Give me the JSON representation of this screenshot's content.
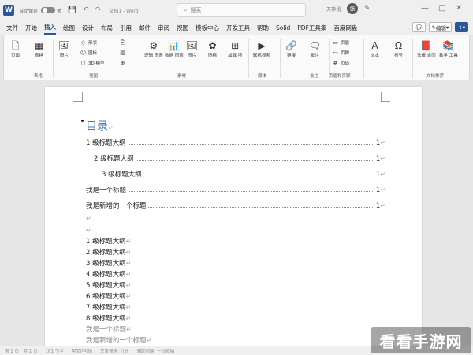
{
  "titlebar": {
    "app_icon": "W",
    "autosave_label": "自动保存",
    "toggle_state": "关",
    "doc_title": "文档1 - Word",
    "search_placeholder": "搜索",
    "user_name": "天神 张",
    "avatar_letter": "张",
    "window_controls": [
      "—",
      "▢",
      "✕"
    ]
  },
  "menu": {
    "tabs": [
      "文件",
      "开始",
      "插入",
      "绘图",
      "设计",
      "布局",
      "引用",
      "邮件",
      "审阅",
      "视图",
      "模板中心",
      "开发工具",
      "帮助",
      "Solid",
      "PDF工具集",
      "百度网盘"
    ],
    "active_tab": "插入",
    "comment_btn": "💬",
    "edit_btn": "编辑",
    "share_btn": "共享"
  },
  "ribbon": {
    "pages_label": "页面",
    "table_label": "表格",
    "picture_label": "图片",
    "shapes_label": "形状",
    "icons_label": "图标",
    "model3d_label": "3D 模型",
    "smartart_label": "SmartArt",
    "chart_label": "图表",
    "screenshot_label": "屏幕截图",
    "logic_label": "逻辑\n图表",
    "data_label": "数据\n图表",
    "img_label": "图片",
    "icon2_label": "图标",
    "addins_label": "加载\n项",
    "video_label": "联机视频",
    "link_label": "链接",
    "comment_label": "批注",
    "header_label": "页眉",
    "footer_label": "页脚",
    "pagenum_label": "页码",
    "textbox_label": "文本",
    "symbol_label": "符号",
    "legal_label": "法律\n合同",
    "edu_label": "教学\n工具",
    "group_table": "表格",
    "group_illus": "插图",
    "group_material": "素材",
    "group_media": "媒体",
    "group_comment": "批注",
    "group_header": "页眉和页脚",
    "group_docrec": "文档推荐"
  },
  "document": {
    "toc_title": "目录",
    "toc_entries": [
      {
        "text": "1 级标题大纲",
        "page": "1",
        "indent": 0
      },
      {
        "text": "2 级标题大纲",
        "page": "1",
        "indent": 1
      },
      {
        "text": "3 级标题大纲",
        "page": "1",
        "indent": 2
      },
      {
        "text": "我是一个标题",
        "page": "1",
        "indent": 0
      },
      {
        "text": "我是新增的一个标题",
        "page": "1",
        "indent": 0
      }
    ],
    "body_lines": [
      "1 级标题大纲",
      "2 级标题大纲",
      "3 级标题大纲",
      "4 级标题大纲",
      "5 级标题大纲",
      "6 级标题大纲",
      "7 级标题大纲",
      "8 级标题大纲"
    ],
    "faint_lines": [
      "我是一个标题",
      "我是新增的一个标题"
    ],
    "para_mark": "↵"
  },
  "statusbar": {
    "items": [
      "第 1 页，共 1 页",
      "161 个字",
      "中文(中国)",
      "文本预测: 打开",
      "辅助功能: 一切就绪"
    ]
  },
  "watermark": "看看手游网"
}
